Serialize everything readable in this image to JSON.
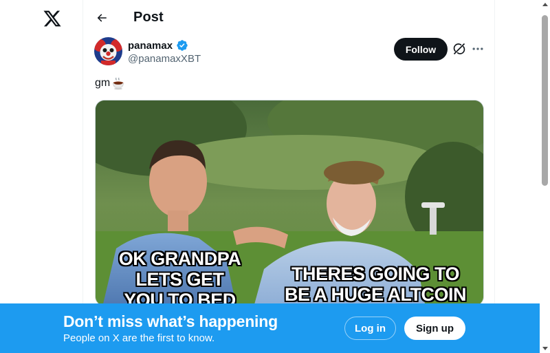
{
  "nav": {
    "logo_icon": "x-logo-icon"
  },
  "header": {
    "back_icon": "arrow-left-icon",
    "title": "Post"
  },
  "post": {
    "author": {
      "display_name": "panamax",
      "handle": "@panamaxXBT",
      "verified": true,
      "verified_color": "#1d9bf0",
      "avatar_icon": "clown-avatar"
    },
    "follow_label": "Follow",
    "grok_icon": "grok-icon",
    "more_icon": "more-horizontal-icon",
    "text": "gm",
    "text_emoji_icon": "hot-beverage-icon",
    "media": {
      "left_caption": "OK GRANDPA\nLETS GET\nYOU TO BED",
      "right_caption": "THERES GOING TO\nBE A HUGE ALTCOIN"
    }
  },
  "banner": {
    "background_color": "#1d9bf0",
    "title": "Don’t miss what’s happening",
    "subtitle": "People on X are the first to know.",
    "login_label": "Log in",
    "signup_label": "Sign up"
  }
}
